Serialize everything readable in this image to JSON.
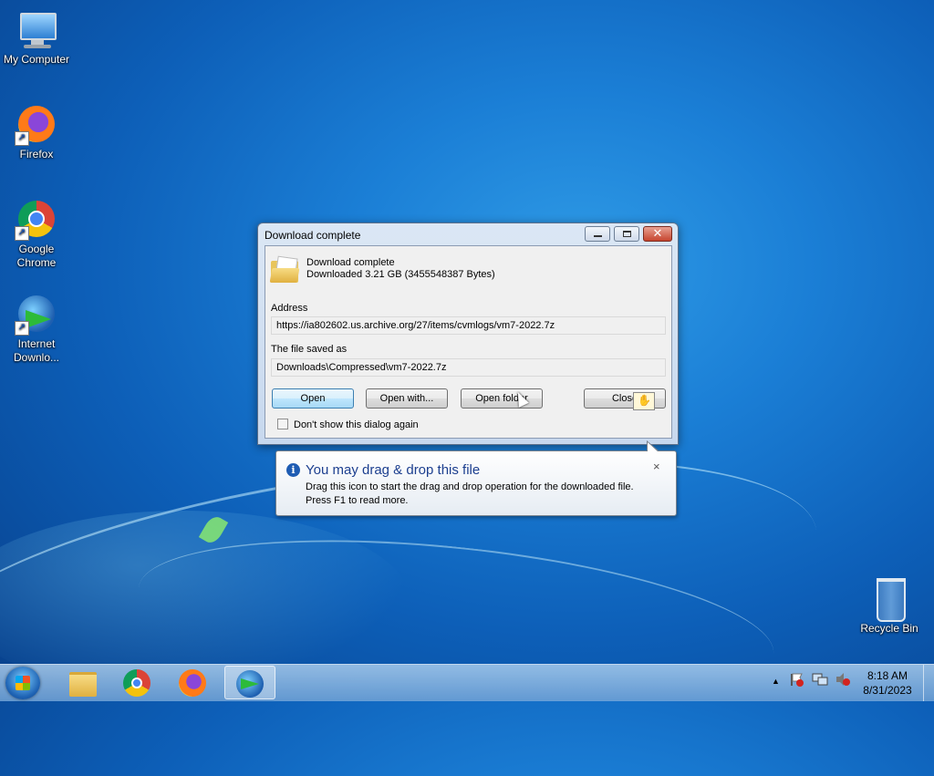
{
  "desktop": {
    "icons": [
      {
        "label": "My Computer"
      },
      {
        "label": "Firefox"
      },
      {
        "label": "Google Chrome"
      },
      {
        "label": "Internet Downlo..."
      },
      {
        "label": "Recycle Bin"
      }
    ]
  },
  "dialog": {
    "title": "Download complete",
    "heading": "Download complete",
    "downloaded": "Downloaded 3.21  GB (3455548387 Bytes)",
    "address_label": "Address",
    "address_value": "https://ia802602.us.archive.org/27/items/cvmlogs/vm7-2022.7z",
    "saved_label": "The file saved as",
    "saved_value": "Downloads\\Compressed\\vm7-2022.7z",
    "buttons": {
      "open": "Open",
      "open_with": "Open with...",
      "open_folder": "Open folder",
      "close": "Close"
    },
    "checkbox_label": "Don't show this dialog again",
    "checkbox_checked": false
  },
  "tooltip": {
    "title": "You may drag & drop this file",
    "body_line1": "Drag this icon to start the drag and drop operation for the downloaded file.",
    "body_line2": "Press F1 to read more.",
    "close": "×"
  },
  "taskbar": {
    "time": "8:18 AM",
    "date": "8/31/2023",
    "show_hidden": "▲"
  },
  "colors": {
    "desktop": "#1b7fd6",
    "tooltip_title": "#1c3f8f",
    "close_button": "#c6452f"
  }
}
